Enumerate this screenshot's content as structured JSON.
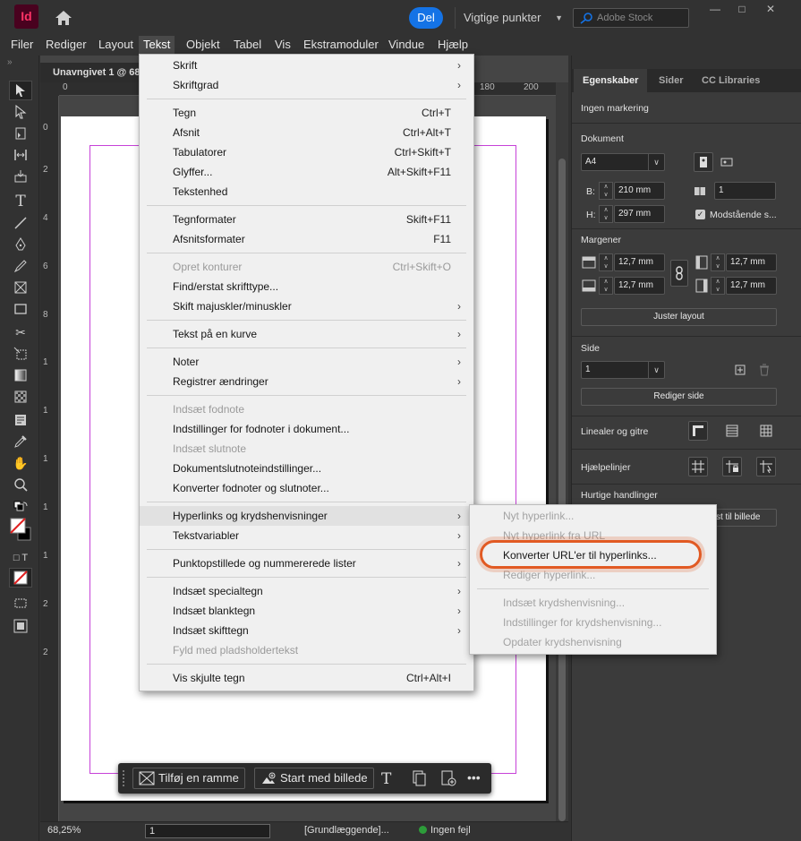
{
  "app": {
    "logo_text": "Id",
    "share_label": "Del",
    "workspace": "Vigtige punkter",
    "stock_placeholder": "Adobe Stock"
  },
  "menubar": [
    "Filer",
    "Rediger",
    "Layout",
    "Tekst",
    "Objekt",
    "Tabel",
    "Vis",
    "Ekstramoduler",
    "Vindue",
    "Hjælp"
  ],
  "document": {
    "tab_title": "Unavngivet 1 @ 68",
    "ruler_h": [
      "0",
      "180",
      "200"
    ],
    "ruler_v": [
      "0",
      "2",
      "4",
      "6",
      "8",
      "1",
      "1",
      "1",
      "1",
      "1",
      "2",
      "2"
    ]
  },
  "text_menu": {
    "items": [
      {
        "label": "Skrift",
        "shortcut": "",
        "submenu": true,
        "disabled": false
      },
      {
        "label": "Skriftgrad",
        "shortcut": "",
        "submenu": true,
        "disabled": false
      },
      {
        "label": "Tegn",
        "shortcut": "Ctrl+T",
        "submenu": false,
        "disabled": false
      },
      {
        "label": "Afsnit",
        "shortcut": "Ctrl+Alt+T",
        "submenu": false,
        "disabled": false
      },
      {
        "label": "Tabulatorer",
        "shortcut": "Ctrl+Skift+T",
        "submenu": false,
        "disabled": false
      },
      {
        "label": "Glyffer...",
        "shortcut": "Alt+Skift+F11",
        "submenu": false,
        "disabled": false
      },
      {
        "label": "Tekstenhed",
        "shortcut": "",
        "submenu": false,
        "disabled": false
      },
      {
        "label": "Tegnformater",
        "shortcut": "Skift+F11",
        "submenu": false,
        "disabled": false
      },
      {
        "label": "Afsnitsformater",
        "shortcut": "F11",
        "submenu": false,
        "disabled": false
      },
      {
        "label": "Opret konturer",
        "shortcut": "Ctrl+Skift+O",
        "submenu": false,
        "disabled": true
      },
      {
        "label": "Find/erstat skrifttype...",
        "shortcut": "",
        "submenu": false,
        "disabled": false
      },
      {
        "label": "Skift majuskler/minuskler",
        "shortcut": "",
        "submenu": true,
        "disabled": false
      },
      {
        "label": "Tekst på en kurve",
        "shortcut": "",
        "submenu": true,
        "disabled": false
      },
      {
        "label": "Noter",
        "shortcut": "",
        "submenu": true,
        "disabled": false
      },
      {
        "label": "Registrer ændringer",
        "shortcut": "",
        "submenu": true,
        "disabled": false
      },
      {
        "label": "Indsæt fodnote",
        "shortcut": "",
        "submenu": false,
        "disabled": true
      },
      {
        "label": "Indstillinger for fodnoter i dokument...",
        "shortcut": "",
        "submenu": false,
        "disabled": false
      },
      {
        "label": "Indsæt slutnote",
        "shortcut": "",
        "submenu": false,
        "disabled": true
      },
      {
        "label": "Dokumentslutnoteindstillinger...",
        "shortcut": "",
        "submenu": false,
        "disabled": false
      },
      {
        "label": "Konverter fodnoter og slutnoter...",
        "shortcut": "",
        "submenu": false,
        "disabled": false
      },
      {
        "label": "Hyperlinks og krydshenvisninger",
        "shortcut": "",
        "submenu": true,
        "disabled": false,
        "highlighted": true
      },
      {
        "label": "Tekstvariabler",
        "shortcut": "",
        "submenu": true,
        "disabled": false
      },
      {
        "label": "Punktopstillede og nummererede lister",
        "shortcut": "",
        "submenu": true,
        "disabled": false
      },
      {
        "label": "Indsæt specialtegn",
        "shortcut": "",
        "submenu": true,
        "disabled": false
      },
      {
        "label": "Indsæt blanktegn",
        "shortcut": "",
        "submenu": true,
        "disabled": false
      },
      {
        "label": "Indsæt skifttegn",
        "shortcut": "",
        "submenu": true,
        "disabled": false
      },
      {
        "label": "Fyld med pladsholdertekst",
        "shortcut": "",
        "submenu": false,
        "disabled": true
      },
      {
        "label": "Vis skjulte tegn",
        "shortcut": "Ctrl+Alt+I",
        "submenu": false,
        "disabled": false
      }
    ]
  },
  "hyperlink_submenu": {
    "items": [
      {
        "label": "Nyt hyperlink...",
        "disabled": true
      },
      {
        "label": "Nyt hyperlink fra URL",
        "disabled": true
      },
      {
        "label": "Konverter URL'er til hyperlinks...",
        "disabled": false
      },
      {
        "label": "Rediger hyperlink...",
        "disabled": true
      },
      {
        "label": "Indsæt krydshenvisning...",
        "disabled": true
      },
      {
        "label": "Indstillinger for krydshenvisning...",
        "disabled": true
      },
      {
        "label": "Opdater krydshenvisning",
        "disabled": true
      }
    ]
  },
  "context_bar": {
    "add_frame": "Tilføj en ramme",
    "start_image": "Start med billede"
  },
  "status": {
    "zoom": "68,25%",
    "page": "1",
    "profile": "[Grundlæggende]...",
    "errors": "Ingen fejl"
  },
  "panel": {
    "tabs": [
      "Egenskaber",
      "Sider",
      "CC Libraries"
    ],
    "selection": "Ingen markering",
    "document_label": "Dokument",
    "preset": "A4",
    "width_label": "B:",
    "width": "210 mm",
    "height_label": "H:",
    "height": "297 mm",
    "pages": "1",
    "facing_pages": "Modstående s...",
    "margins_label": "Margener",
    "margin_top": "12,7 mm",
    "margin_bottom": "12,7 mm",
    "margin_left": "12,7 mm",
    "margin_right": "12,7 mm",
    "adjust_layout": "Juster layout",
    "page_label": "Side",
    "page_value": "1",
    "edit_page": "Rediger side",
    "rulers_grids": "Linealer og gitre",
    "guides": "Hjælpelinjer",
    "quick_actions": "Hurtige handlinger",
    "quick_action_btn": "st til billede"
  },
  "colors": {
    "accent": "#1473e6",
    "logo_bg": "#49021f",
    "logo_fg": "#ff3366",
    "highlight_ring": "#e15a23",
    "margin_guide": "#c642d8"
  }
}
